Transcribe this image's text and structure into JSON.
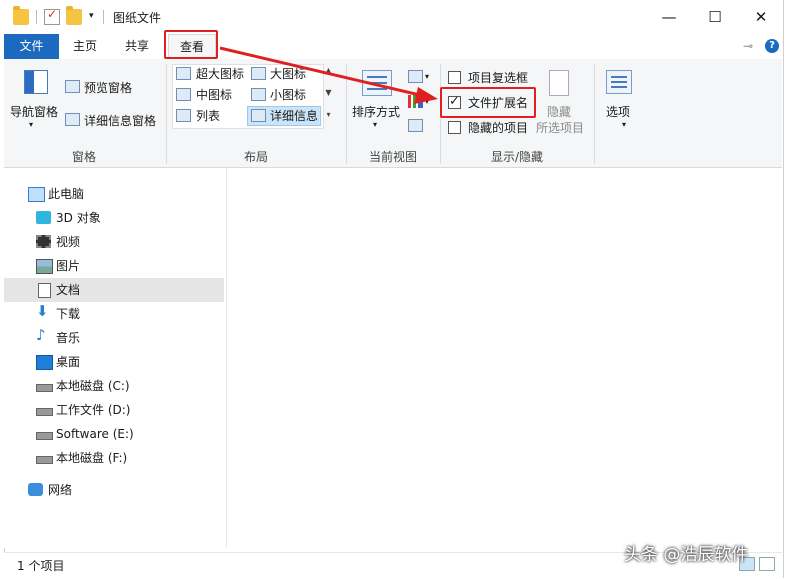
{
  "window": {
    "title": "图纸文件"
  },
  "window_controls": {
    "minimize": "—",
    "maximize": "☐",
    "close": "✕"
  },
  "tabs": {
    "file": "文件",
    "home": "主页",
    "share": "共享",
    "view": "查看"
  },
  "ribbon": {
    "panes": {
      "nav_pane": "导航窗格",
      "preview_pane": "预览窗格",
      "details_pane": "详细信息窗格",
      "group": "窗格"
    },
    "layout": {
      "xlarge": "超大图标",
      "large": "大图标",
      "medium": "中图标",
      "small": "小图标",
      "list": "列表",
      "details": "详细信息",
      "group": "布局"
    },
    "current_view": {
      "sort": "排序方式",
      "group": "当前视图"
    },
    "show_hide": {
      "item_checkboxes": "项目复选框",
      "file_extensions": "文件扩展名",
      "hidden_items": "隐藏的项目",
      "hide_line1": "隐藏",
      "hide_line2": "所选项目",
      "group": "显示/隐藏",
      "file_extensions_checked": true,
      "item_checkboxes_checked": false,
      "hidden_items_checked": false
    },
    "options": "选项"
  },
  "nav": {
    "this_pc": "此电脑",
    "items": [
      {
        "label": "3D 对象",
        "icon": "cube-icon"
      },
      {
        "label": "视频",
        "icon": "film-icon"
      },
      {
        "label": "图片",
        "icon": "picture-icon"
      },
      {
        "label": "文档",
        "icon": "document-icon"
      },
      {
        "label": "下载",
        "icon": "download-arrow-icon"
      },
      {
        "label": "音乐",
        "icon": "music-note-icon"
      },
      {
        "label": "桌面",
        "icon": "desktop-icon"
      },
      {
        "label": "本地磁盘 (C:)",
        "icon": "drive-icon"
      },
      {
        "label": "工作文件 (D:)",
        "icon": "drive-icon"
      },
      {
        "label": "Software (E:)",
        "icon": "drive-icon"
      },
      {
        "label": "本地磁盘 (F:)",
        "icon": "drive-icon"
      }
    ],
    "network": "网络"
  },
  "status": {
    "count": "1 个项目"
  },
  "watermark": "头条 @浩辰软件",
  "colors": {
    "accent": "#1c6ac0",
    "highlight": "#e02020",
    "selected": "#cce4f7"
  }
}
